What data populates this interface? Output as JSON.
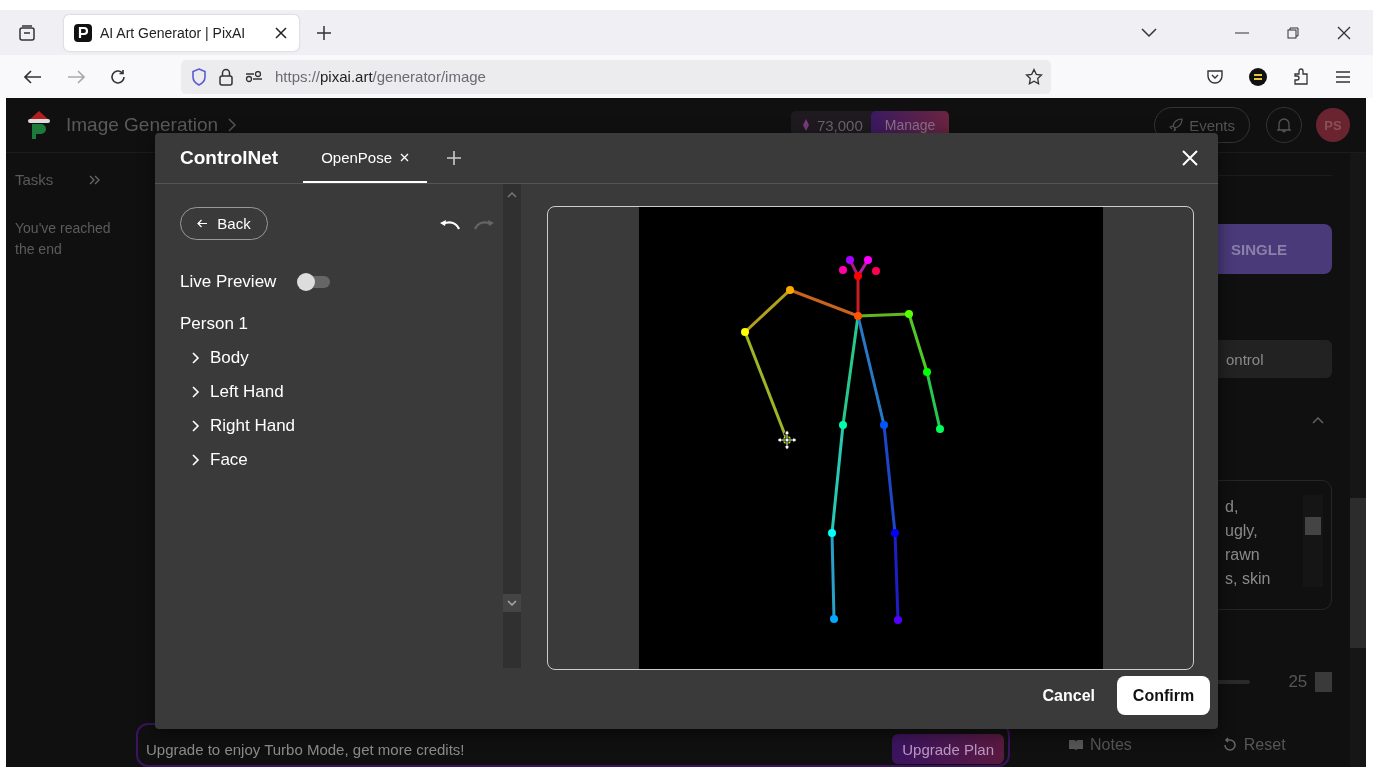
{
  "browser": {
    "tab_title": "AI Art Generator | PixAI",
    "url_scheme": "https://",
    "url_host": "pixai.art",
    "url_path": "/generator/image"
  },
  "header": {
    "title": "Image Generation",
    "credits": "73,000",
    "manage": "Manage",
    "events": "Events",
    "avatar": "PS"
  },
  "sidebar": {
    "tasks": "Tasks",
    "end_message": "You've reached the end"
  },
  "right_panel": {
    "mode_button": "SINGLE",
    "control_button": "ontrol",
    "prompt_lines": [
      "d,",
      "ugly,",
      "rawn",
      "s, skin"
    ],
    "steps_value": "25",
    "notes": "Notes",
    "reset": "Reset"
  },
  "bottom_bar": {
    "message": "Upgrade to enjoy Turbo Mode, get more credits!",
    "button": "Upgrade Plan"
  },
  "modal": {
    "title": "ControlNet",
    "tabs": [
      {
        "label": "OpenPose",
        "selected": true
      }
    ],
    "back": "Back",
    "live_preview": {
      "label": "Live Preview",
      "on": false
    },
    "person": "Person 1",
    "parts": [
      {
        "label": "Body",
        "expanded": false
      },
      {
        "label": "Left Hand",
        "expanded": false
      },
      {
        "label": "Right Hand",
        "expanded": false
      },
      {
        "label": "Face",
        "expanded": false
      }
    ],
    "cancel": "Cancel",
    "confirm": "Confirm"
  }
}
